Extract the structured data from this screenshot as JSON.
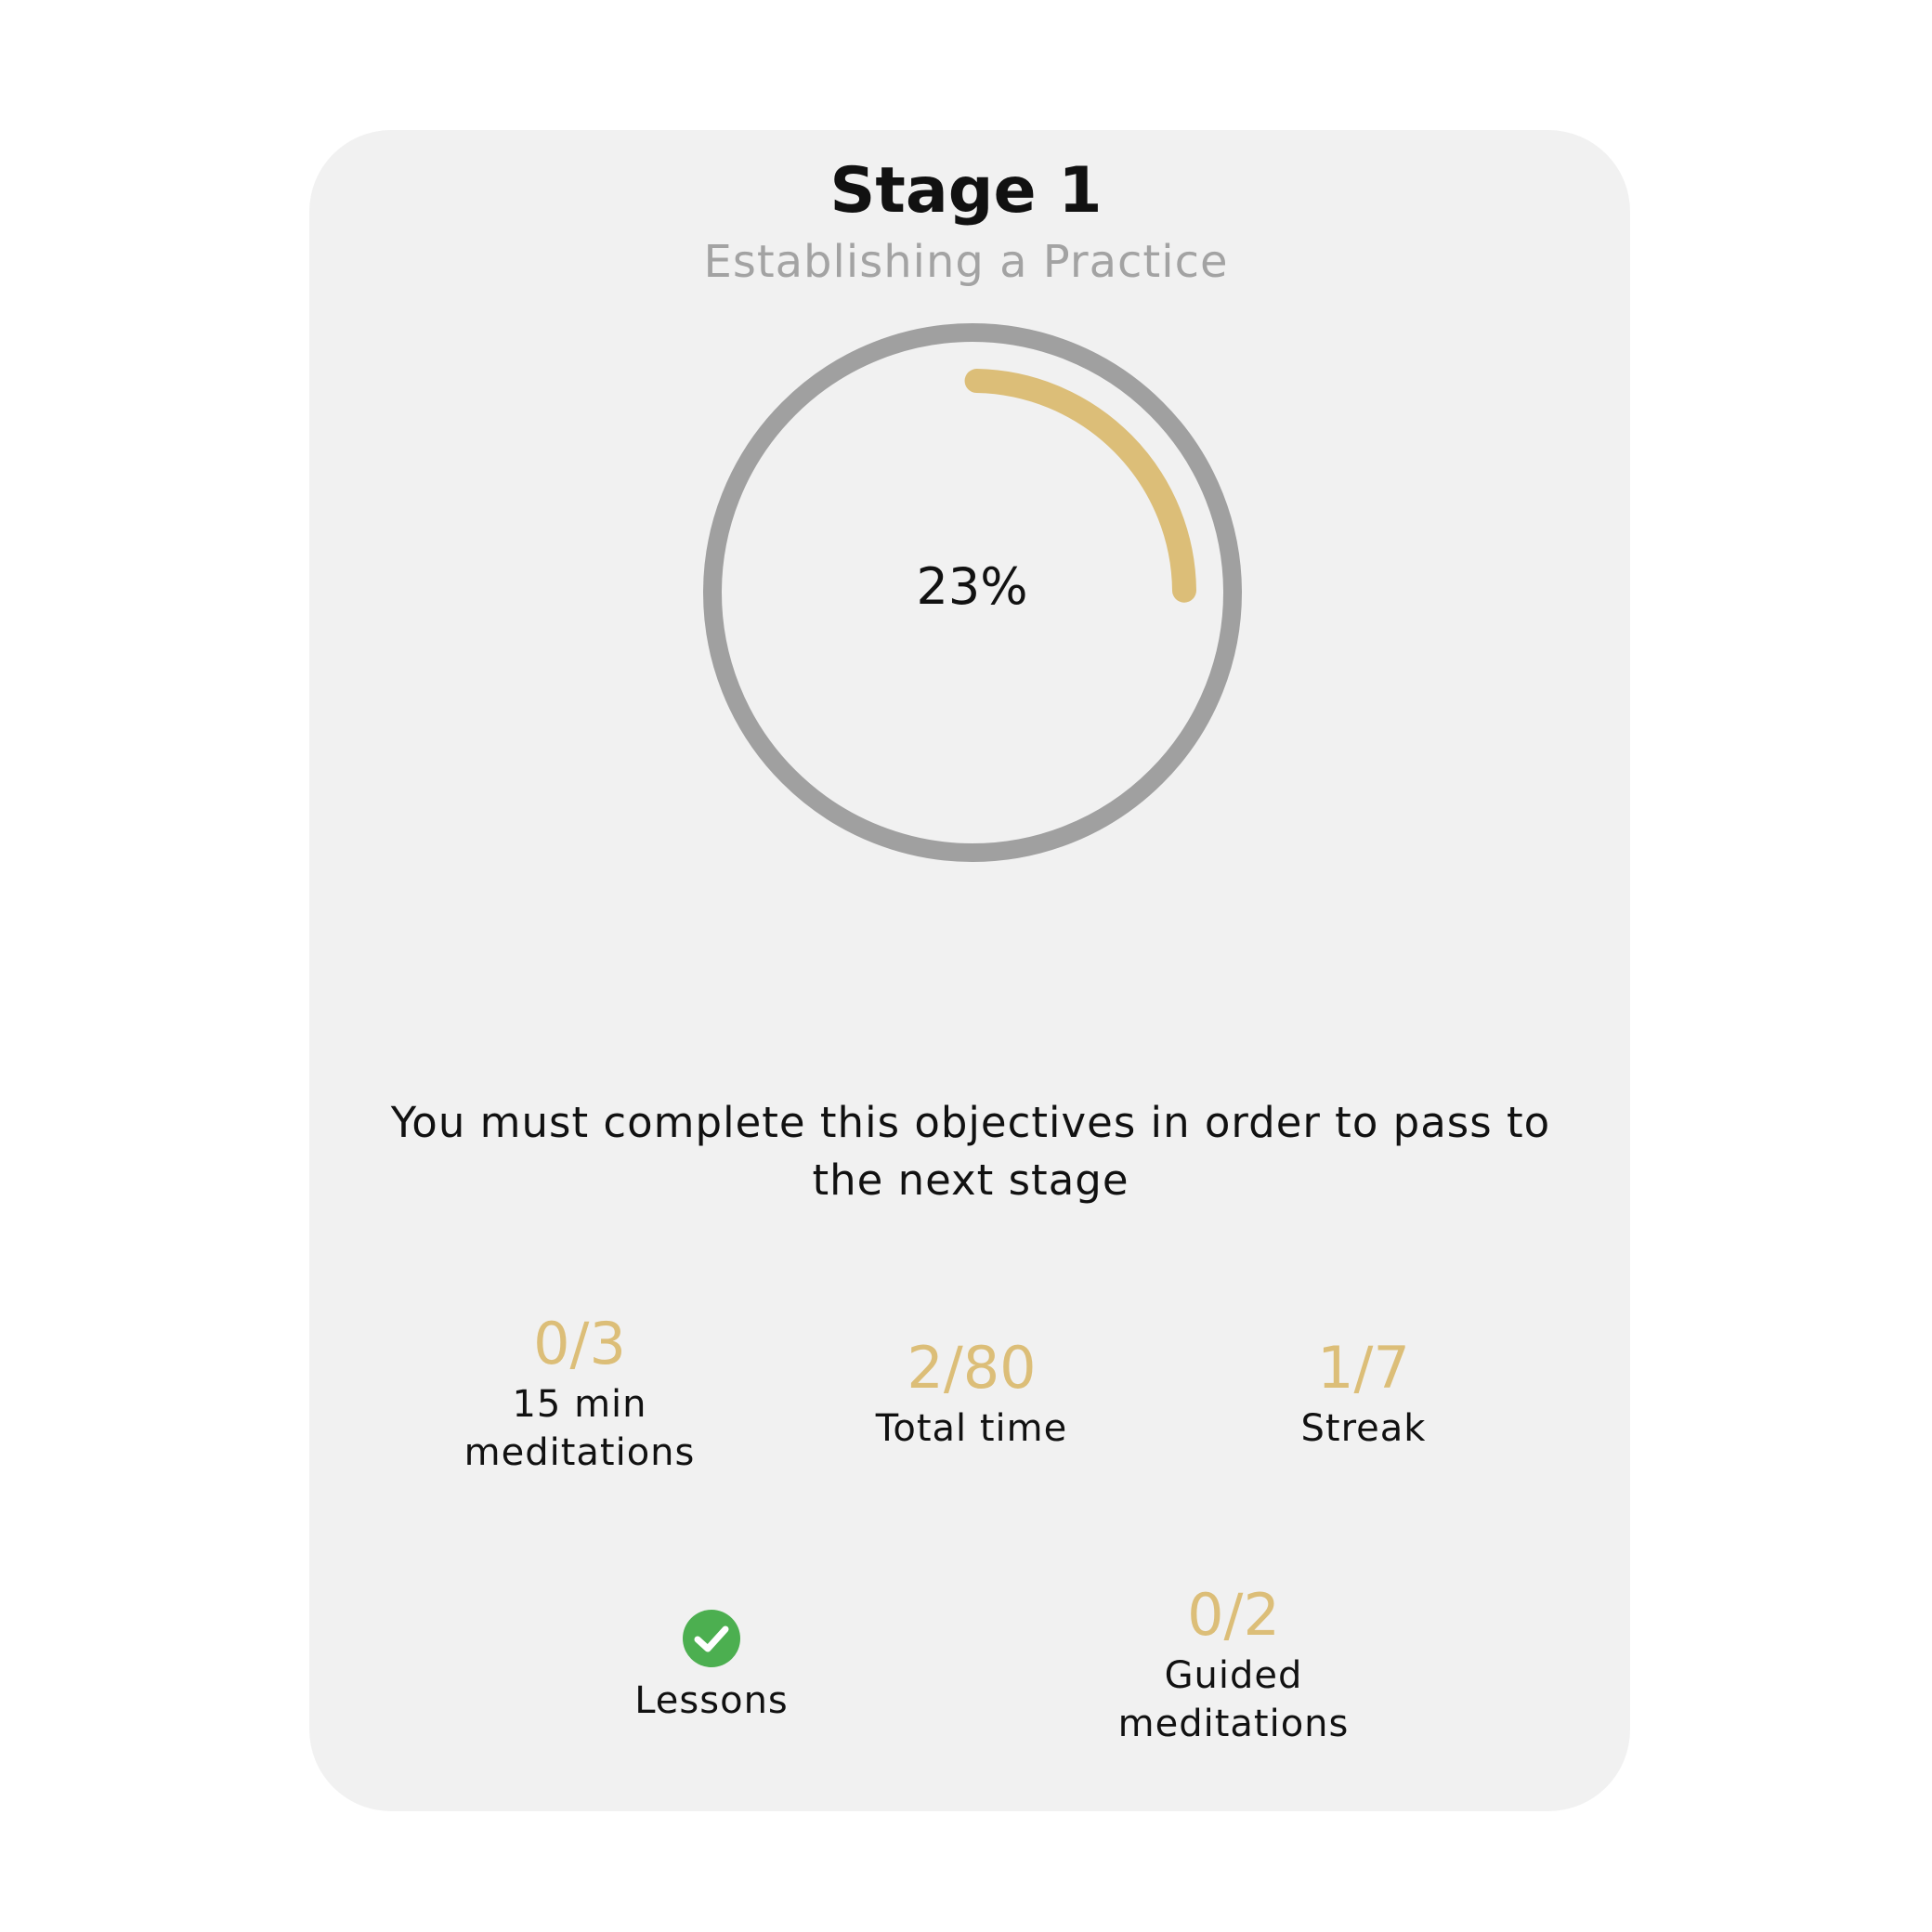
{
  "stage": {
    "title": "Stage 1",
    "subtitle": "Establishing a Practice"
  },
  "progress": {
    "percent_label": "23%",
    "fraction": 0.23,
    "track_color": "#a0a0a0",
    "fill_color": "#dcbe78"
  },
  "instructions": "You must complete this objectives in order to pass to the next stage",
  "objectives": {
    "meditations_15": {
      "count": "0/3",
      "label_line1": "15 min",
      "label_line2": "meditations"
    },
    "total_time": {
      "count": "2/80",
      "label": "Total time"
    },
    "streak": {
      "count": "1/7",
      "label": "Streak"
    },
    "lessons": {
      "label": "Lessons",
      "icon": "check-circle-icon",
      "completed": true,
      "icon_color": "#4caf50"
    },
    "guided": {
      "count": "0/2",
      "label_line1": "Guided",
      "label_line2": "meditations"
    }
  }
}
